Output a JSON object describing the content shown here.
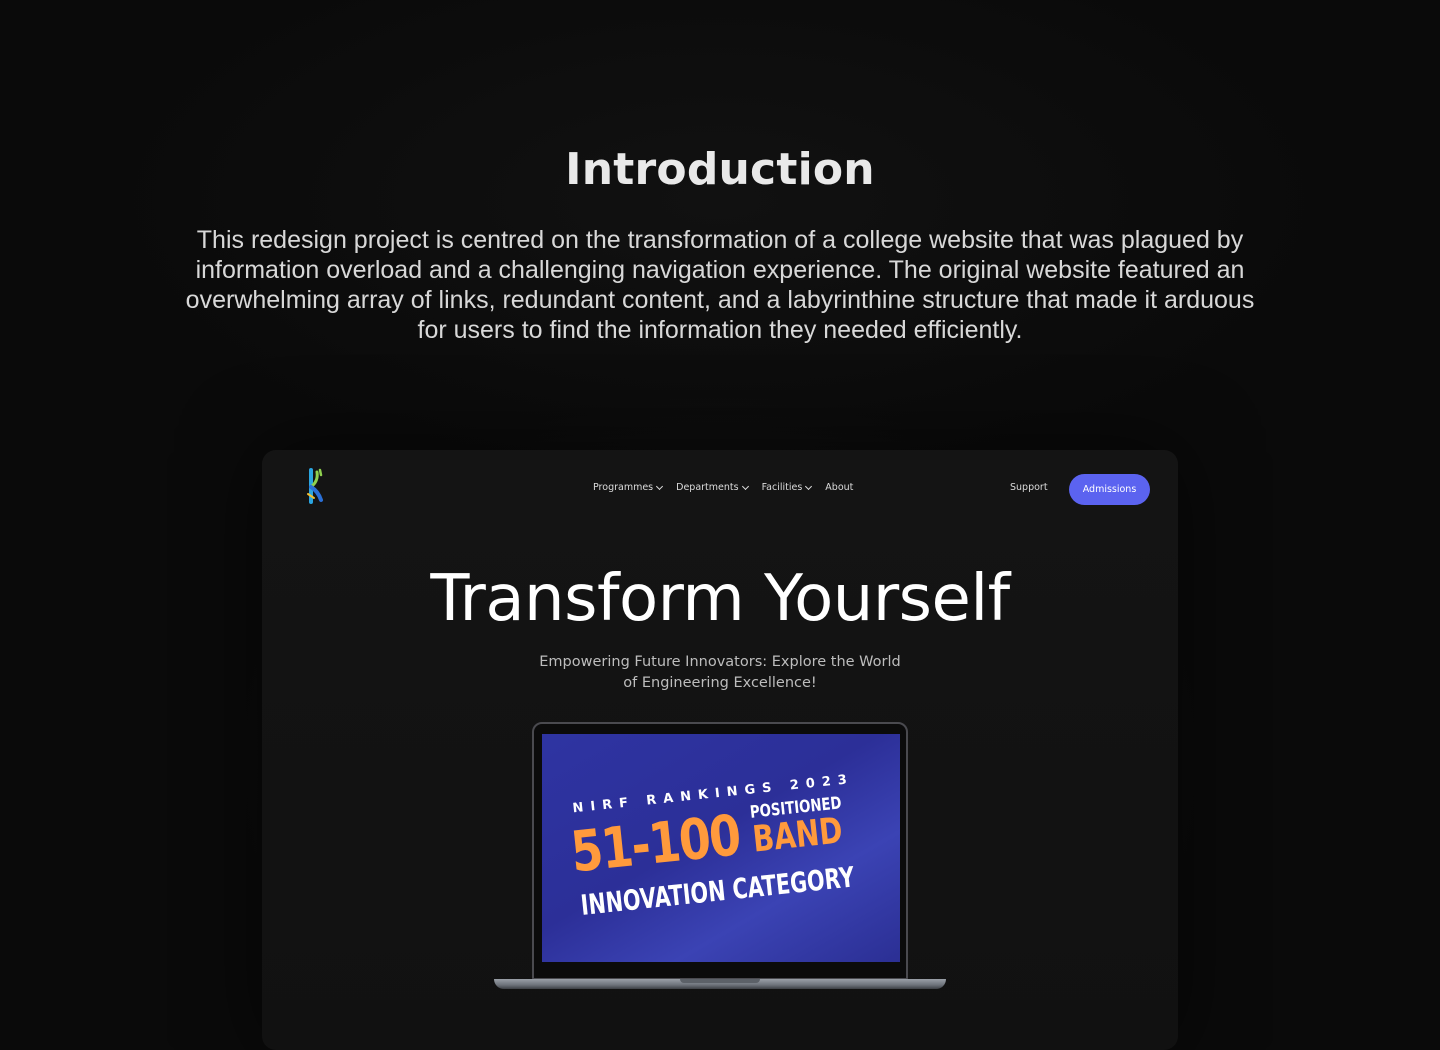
{
  "intro": {
    "title": "Introduction",
    "body": "This redesign project is centred on the transformation of a college website that was plagued by information overload and a challenging navigation experience. The original website featured an overwhelming array of links, redundant content, and a labyrinthine structure that made it arduous for users to find the information they needed efficiently."
  },
  "site": {
    "nav": [
      {
        "label": "Programmes",
        "has_dropdown": true
      },
      {
        "label": "Departments",
        "has_dropdown": true
      },
      {
        "label": "Facilities",
        "has_dropdown": true
      },
      {
        "label": "About",
        "has_dropdown": false
      }
    ],
    "support_label": "Support",
    "admissions_label": "Admissions",
    "hero_title": "Transform Yourself",
    "hero_subtitle_line1": "Empowering Future Innovators: Explore the World",
    "hero_subtitle_line2": "of Engineering Excellence!",
    "banner": {
      "heading": "NIRF RANKINGS 2023",
      "rank": "51-100",
      "positioned": "POSITIONED",
      "band": "BAND",
      "category": "INNOVATION CATEGORY"
    }
  },
  "colors": {
    "page_bg": "#0a0a0a",
    "accent": "#5b63f0",
    "banner_bg": "#2e34a2",
    "banner_highlight": "#ff9a3c"
  },
  "icons": {
    "logo": "college-logo-icon",
    "dropdown": "chevron-down-icon"
  }
}
